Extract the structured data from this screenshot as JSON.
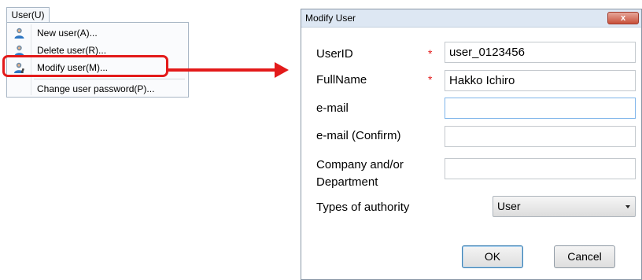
{
  "menu": {
    "title": "User(U)",
    "items": [
      {
        "label": "New user(A)...",
        "icon": "user-icon"
      },
      {
        "label": "Delete user(R)...",
        "icon": "user-icon"
      },
      {
        "label": "Modify user(M)...",
        "icon": "user-edit-icon"
      },
      {
        "label": "Change user password(P)...",
        "icon": ""
      }
    ]
  },
  "dialog": {
    "title": "Modify User",
    "close_label": "x",
    "required_mark": "*",
    "fields": {
      "userid": {
        "label": "UserID",
        "value": "user_0123456"
      },
      "fullname": {
        "label": "FullName",
        "value": "Hakko Ichiro"
      },
      "email": {
        "label": "e-mail",
        "value": ""
      },
      "email_confirm": {
        "label": "e-mail (Confirm)",
        "value": ""
      },
      "company": {
        "label_line1": "Company and/or",
        "label_line2": "Department",
        "value": ""
      }
    },
    "authority": {
      "label": "Types of authority",
      "selected": "User"
    },
    "ok_label": "OK",
    "cancel_label": "Cancel"
  },
  "colors": {
    "highlight": "#e31a1a",
    "required": "#e31a1a",
    "titlebar": "#dde7f3"
  }
}
